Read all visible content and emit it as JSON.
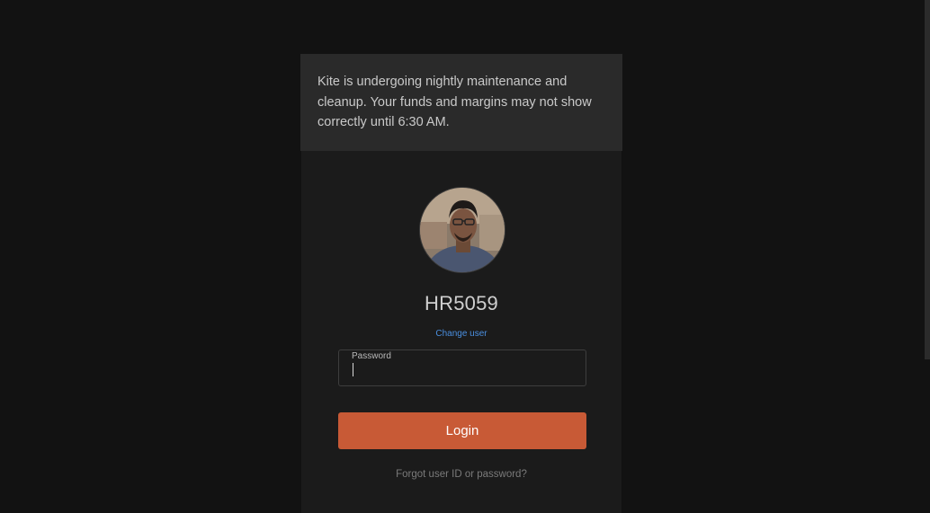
{
  "notice": {
    "text": "Kite is undergoing nightly maintenance and cleanup. Your funds and margins may not show correctly until 6:30 AM."
  },
  "user": {
    "id": "HR5059",
    "change_user_label": "Change user",
    "avatar_icon": "user-photo"
  },
  "password_field": {
    "label": "Password",
    "value": ""
  },
  "login_button": {
    "label": "Login"
  },
  "forgot_link": {
    "label": "Forgot user ID or password?"
  },
  "colors": {
    "background": "#121212",
    "notice_bg": "#2a2a2a",
    "card_bg": "#1b1b1b",
    "accent": "#c85a36",
    "link": "#4a8fe0"
  }
}
